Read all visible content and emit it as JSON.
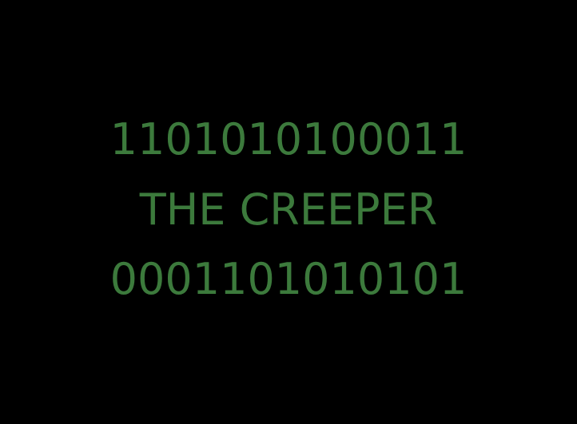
{
  "theme": {
    "background": "#000000",
    "text_color": "#3c7a3c"
  },
  "message": {
    "line1": "1101010100011",
    "line2": "THE CREEPER",
    "line3": "0001101010101"
  }
}
